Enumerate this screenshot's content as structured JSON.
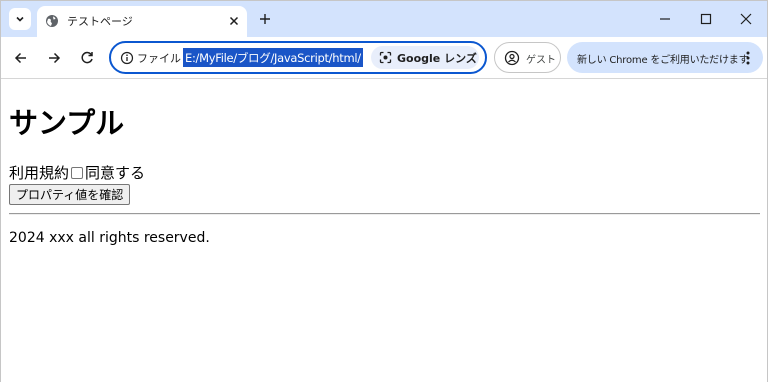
{
  "tab": {
    "title": "テストページ"
  },
  "toolbar": {
    "scheme_label": "ファイル",
    "url": "E:/MyFile/ブログ/JavaScript/html/",
    "lens_label": "Google レンズ",
    "guest_label": "ゲスト",
    "promo_label": "新しい Chrome をご利用いただけます"
  },
  "page": {
    "heading": "サンプル",
    "terms_label": "利用規約",
    "agree_label": "同意する",
    "check_button_label": "プロパティ値を確認",
    "footer": "2024 xxx all rights reserved."
  },
  "colors": {
    "tabstrip": "#d3e3fd",
    "accent": "#0b57d0",
    "url_highlight": "#1a55c7"
  },
  "icons": [
    "tab-search-icon",
    "globe-icon",
    "close-icon",
    "plus-icon",
    "minimize-icon",
    "maximize-icon",
    "window-close-icon",
    "back-icon",
    "forward-icon",
    "reload-icon",
    "info-icon",
    "lens-icon",
    "guest-icon",
    "menu-dots-icon"
  ]
}
